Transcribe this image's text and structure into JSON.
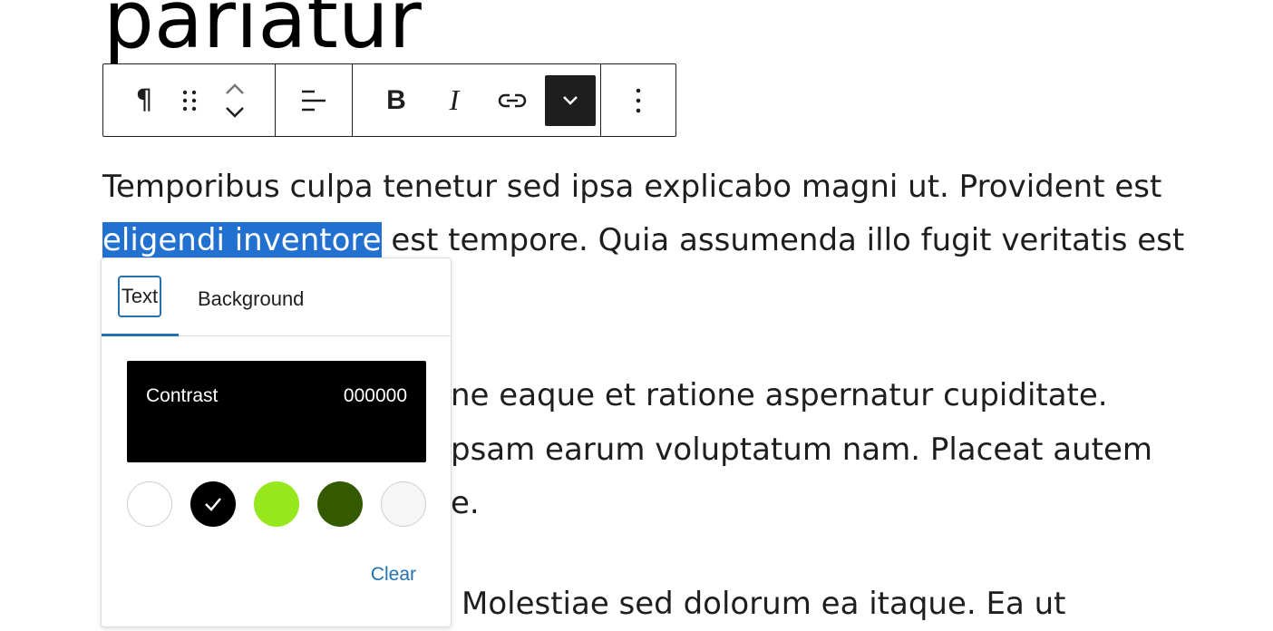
{
  "heading": {
    "text": "pariatur"
  },
  "paragraph": {
    "line1": "Temporibus culpa tenetur sed ipsa explicabo magni ut. Provident est",
    "line2_selected": "eligendi inventore",
    "line2_rest": " est tempore. Quia assumenda illo fugit veritatis est",
    "line3_visible": "ne eaque et ratione aspernatur cupiditate.",
    "line4_visible": "psam earum voluptatum nam. Placeat autem",
    "line5_visible": "e.",
    "line6_visible": "Molestiae sed dolorum ea itaque. Ea ut"
  },
  "toolbar": {
    "paragraph_glyph": "¶",
    "bold_glyph": "B",
    "italic_glyph": "I"
  },
  "color_popover": {
    "tabs": [
      {
        "label": "Text",
        "active": true
      },
      {
        "label": "Background",
        "active": false
      }
    ],
    "preview": {
      "name": "Contrast",
      "hex": "000000",
      "background": "#000000",
      "text_color": "#ffffff"
    },
    "swatches": [
      {
        "name": "white",
        "color": "#ffffff",
        "selected": false
      },
      {
        "name": "contrast",
        "color": "#000000",
        "selected": true
      },
      {
        "name": "light-green",
        "color": "#96e81d",
        "selected": false
      },
      {
        "name": "dark-green",
        "color": "#345a00",
        "selected": false
      },
      {
        "name": "light-gray",
        "color": "#f6f6f7",
        "selected": false
      }
    ],
    "clear_label": "Clear"
  },
  "colors": {
    "selection": "#2271d1",
    "accent": "#2271b1",
    "text": "#1e1e1e"
  }
}
